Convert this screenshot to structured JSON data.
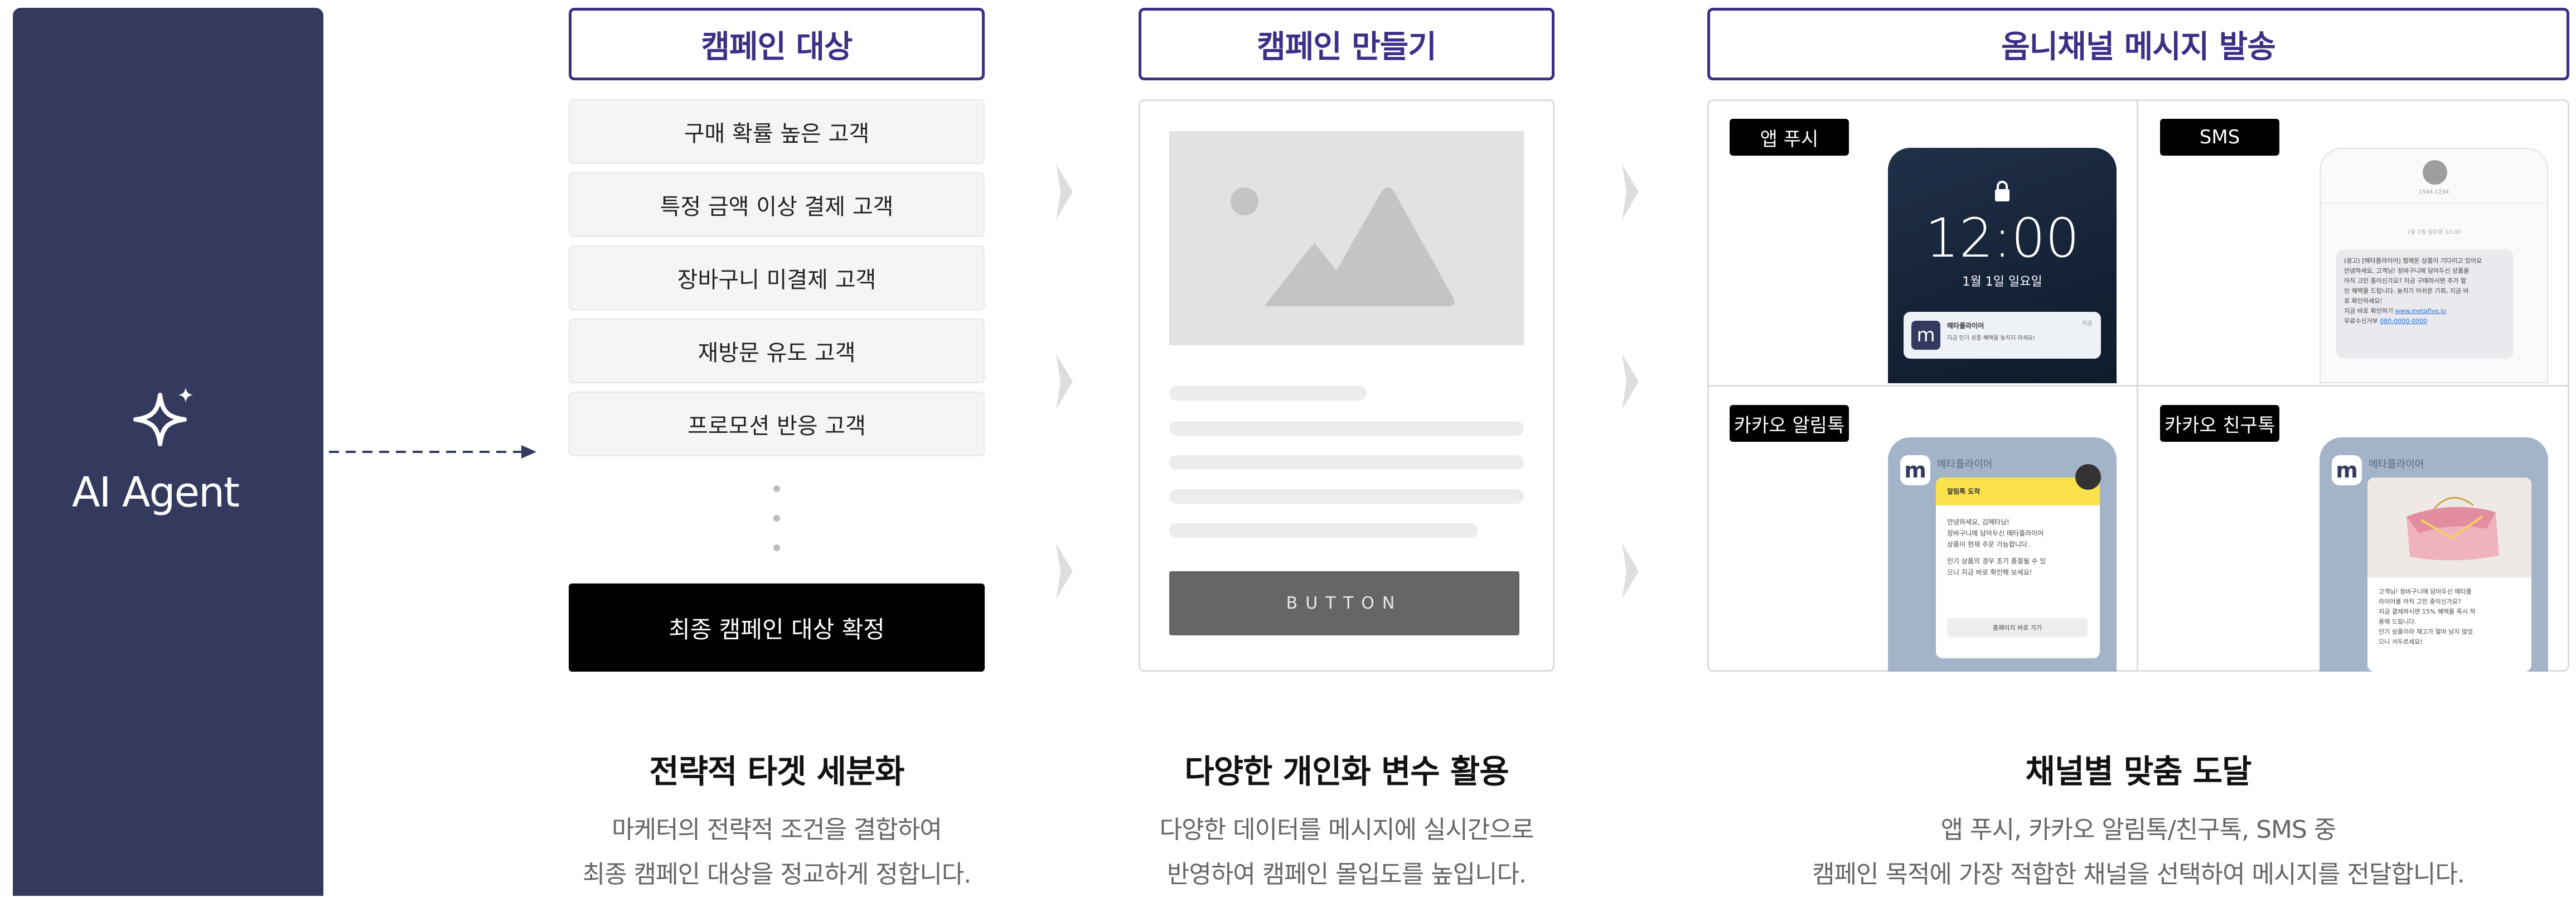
{
  "agent": {
    "label": "AI Agent"
  },
  "columns": {
    "targets": {
      "header": "캠페인 대상",
      "segments": [
        "구매 확률 높은 고객",
        "특정 금액 이상 결제 고객",
        "장바구니 미결제 고객",
        "재방문 유도 고객",
        "프로모션 반응 고객"
      ],
      "confirm": "최종 캠페인 대상 확정",
      "title": "전략적 타겟 세분화",
      "desc1": "마케터의 전략적 조건을 결합하여",
      "desc2": "최종 캠페인 대상을 정교하게 정합니다."
    },
    "create": {
      "header": "캠페인 만들기",
      "button": "BUTTON",
      "title": "다양한 개인화 변수 활용",
      "desc1": "다양한 데이터를 메시지에 실시간으로",
      "desc2": "반영하여 캠페인 몰입도를 높입니다."
    },
    "channels": {
      "header": "옴니채널 메시지 발송",
      "tags": {
        "push": "앱 푸시",
        "sms": "SMS",
        "alimtalk": "카카오 알림톡",
        "friendtalk": "카카오 친구톡"
      },
      "title": "채널별 맞춤 도달",
      "desc1": "앱 푸시, 카카오 알림톡/친구톡, SMS 중",
      "desc2": "캠페인 목적에 가장 적합한 채널을 선택하여 메시지를 전달합니다."
    }
  },
  "push_preview": {
    "time": "12:00",
    "date": "1월 1일 일요일",
    "app": "메타플라이어",
    "text": "지금 인기 상품 혜택을 놓치지 마세요!",
    "logo": "m",
    "ago": "지금"
  },
  "sms_preview": {
    "sender": "1544-1234",
    "date": "1월 1일 일요일 12:00",
    "l1": "(광고) [메타플라이어] 찜해둔 상품이 기다리고 있어요",
    "l2": "안녕하세요, 고객님! 장바구니에 담아두신 상품을",
    "l3": "아직 고민 중이신가요? 지금 구매하시면 추가 할",
    "l4": "인 혜택을 드립니다. 놓치기 아쉬운 기회, 지금 바",
    "l5": "로 확인하세요!",
    "link_label": "지금 바로 확인하기",
    "link": "www.metafive.io",
    "opt_label": "무료수신거부",
    "opt": "080-0000-0000"
  },
  "alimtalk_preview": {
    "brand": "메타플라이어",
    "banner": "알림톡 도착",
    "l1": "안녕하세요, 김메타님!",
    "l2": "장바구니에 담아두신 메타플라이어",
    "l3": "상품이 현재 주문 가능합니다.",
    "l4": "인기 상품의 경우 조기 품절될 수 있",
    "l5": "으니 지금 바로 확인해 보세요!",
    "btn": "홈페이지 바로 가기",
    "logo": "m"
  },
  "friendtalk_preview": {
    "brand": "메타플라이어",
    "l1": "고객님! 장바구니에 담아두신 메타플",
    "l2": "라이어를 아직 고민 중이신가요?",
    "l3": "지금 결제하시면 15% 혜택을 즉시 적",
    "l4": "용해 드립니다.",
    "l5": "인기 상품이라 재고가 얼마 남지 않았",
    "l6": "으니 서두르세요!",
    "logo": "m"
  },
  "colors": {
    "agent_bg": "#343a5e",
    "accent": "#3d2f86",
    "phone_blue": "#a3b4c9",
    "link": "#2a6fd6"
  },
  "icons": {
    "agent": "sparkle-icon",
    "lock": "lock-icon",
    "image": "image-placeholder-icon",
    "flow": "chevron-right-icon"
  }
}
